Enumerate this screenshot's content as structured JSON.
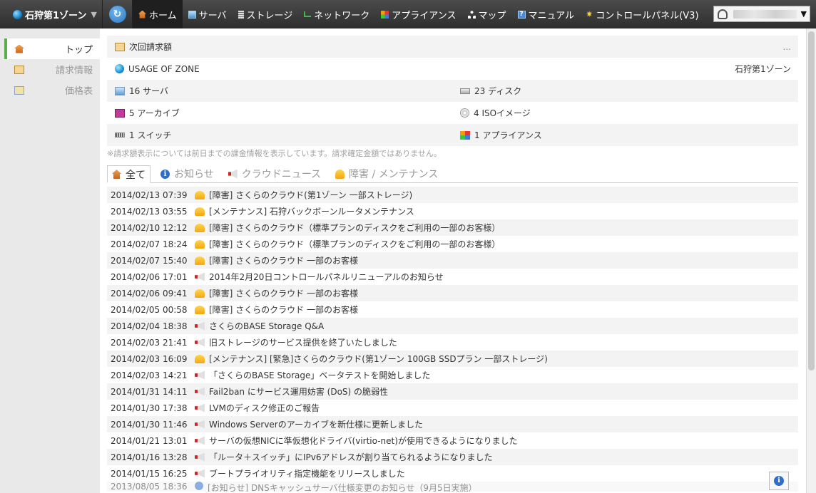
{
  "topbar": {
    "zone_label": "石狩第1ゾーン",
    "zone_caret": "▼",
    "refresh_glyph": "↻",
    "nav": [
      {
        "label": "ホーム",
        "icon": "home-icon",
        "active": true
      },
      {
        "label": "サーバ",
        "icon": "server-icon"
      },
      {
        "label": "ストレージ",
        "icon": "storage-icon"
      },
      {
        "label": "ネットワーク",
        "icon": "network-icon"
      },
      {
        "label": "アプライアンス",
        "icon": "appliance-icon"
      },
      {
        "label": "マップ",
        "icon": "map-icon"
      },
      {
        "label": "マニュアル",
        "icon": "manual-icon"
      },
      {
        "label": "コントロールパネル(V3)",
        "icon": "sun-icon"
      }
    ],
    "user_caret": "▼"
  },
  "sidebar": {
    "items": [
      {
        "label": "トップ",
        "active": true
      },
      {
        "label": "請求情報"
      },
      {
        "label": "価格表"
      }
    ]
  },
  "summary": {
    "next_bill_label": "次回請求額",
    "next_bill_value": "...",
    "usage_label": "USAGE OF ZONE",
    "usage_zone": "石狩第1ゾーン",
    "servers": "16 サーバ",
    "disks": "23 ディスク",
    "archives": "5 アーカイブ",
    "iso": "4 ISOイメージ",
    "switches": "1 スイッチ",
    "appliances": "1 アプライアンス",
    "note": "※請求額表示については前日までの課金情報を表示しています。請求確定金額ではありません。"
  },
  "tabs": [
    {
      "label": "全て",
      "active": true
    },
    {
      "label": "お知らせ"
    },
    {
      "label": "クラウドニュース"
    },
    {
      "label": "障害 / メンテナンス"
    }
  ],
  "news": [
    {
      "date": "2014/02/13 07:39",
      "type": "fault",
      "text": "[障害] さくらのクラウド(第1ゾーン 一部ストレージ)"
    },
    {
      "date": "2014/02/13 03:55",
      "type": "fault",
      "text": "[メンテナンス] 石狩バックボーンルータメンテナンス"
    },
    {
      "date": "2014/02/10 12:12",
      "type": "fault",
      "text": "[障害] さくらのクラウド（標準プランのディスクをご利用の一部のお客様）"
    },
    {
      "date": "2014/02/07 18:24",
      "type": "fault",
      "text": "[障害] さくらのクラウド（標準プランのディスクをご利用の一部のお客様）"
    },
    {
      "date": "2014/02/07 15:40",
      "type": "fault",
      "text": "[障害] さくらのクラウド 一部のお客様"
    },
    {
      "date": "2014/02/06 17:01",
      "type": "news",
      "text": "2014年2月20日コントロールパネルリニューアルのお知らせ"
    },
    {
      "date": "2014/02/06 09:41",
      "type": "fault",
      "text": "[障害] さくらのクラウド 一部のお客様"
    },
    {
      "date": "2014/02/05 00:58",
      "type": "fault",
      "text": "[障害] さくらのクラウド 一部のお客様"
    },
    {
      "date": "2014/02/04 18:38",
      "type": "news",
      "text": "さくらのBASE Storage Q&A"
    },
    {
      "date": "2014/02/03 21:41",
      "type": "news",
      "text": "旧ストレージのサービス提供を終了いたしました"
    },
    {
      "date": "2014/02/03 16:09",
      "type": "fault",
      "text": "[メンテナンス] [緊急]さくらのクラウド(第1ゾーン 100GB SSDプラン 一部ストレージ)"
    },
    {
      "date": "2014/02/03 14:21",
      "type": "news",
      "text": "「さくらのBASE Storage」ベータテストを開始しました"
    },
    {
      "date": "2014/01/31 14:11",
      "type": "news",
      "text": "Fail2ban にサービス運用妨害 (DoS) の脆弱性"
    },
    {
      "date": "2014/01/30 17:38",
      "type": "news",
      "text": "LVMのディスク修正のご報告"
    },
    {
      "date": "2014/01/30 11:46",
      "type": "news",
      "text": "Windows Serverのアーカイブを新仕様に更新しました"
    },
    {
      "date": "2014/01/21 13:01",
      "type": "news",
      "text": "サーバの仮想NICに準仮想化ドライバ(virtio-net)が使用できるようになりました"
    },
    {
      "date": "2014/01/16 13:28",
      "type": "news",
      "text": "「ルータ＋スイッチ」にIPv6アドレスが割り当てられるようになりました"
    },
    {
      "date": "2014/01/15 16:25",
      "type": "news",
      "text": "ブートプライオリティ指定機能をリリースしました"
    },
    {
      "date": "2013/08/05 18:36",
      "type": "info",
      "text": "[お知らせ] DNSキャッシュサーバ仕様変更のお知らせ（9月5日実施）"
    }
  ],
  "help_glyph": "i"
}
